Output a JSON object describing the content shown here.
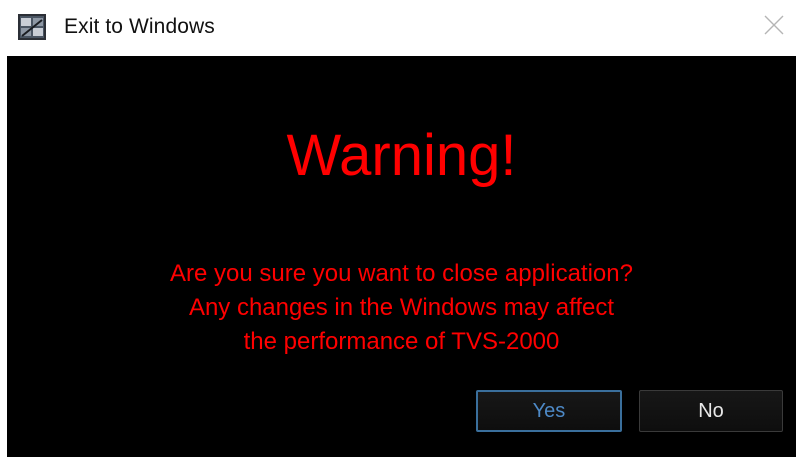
{
  "window": {
    "title": "Exit to Windows",
    "icon": "app-icon",
    "close_icon": "close-icon"
  },
  "dialog": {
    "heading": "Warning!",
    "message_lines": [
      "Are you sure you want to close application?",
      "Any changes in the Windows may affect",
      "the performance of TVS-2000"
    ]
  },
  "buttons": {
    "yes_label": "Yes",
    "no_label": "No"
  },
  "colors": {
    "background": "#000000",
    "warning_text": "#ff0000",
    "focus_border": "#3a6f9c",
    "yes_text": "#4d89c6"
  }
}
